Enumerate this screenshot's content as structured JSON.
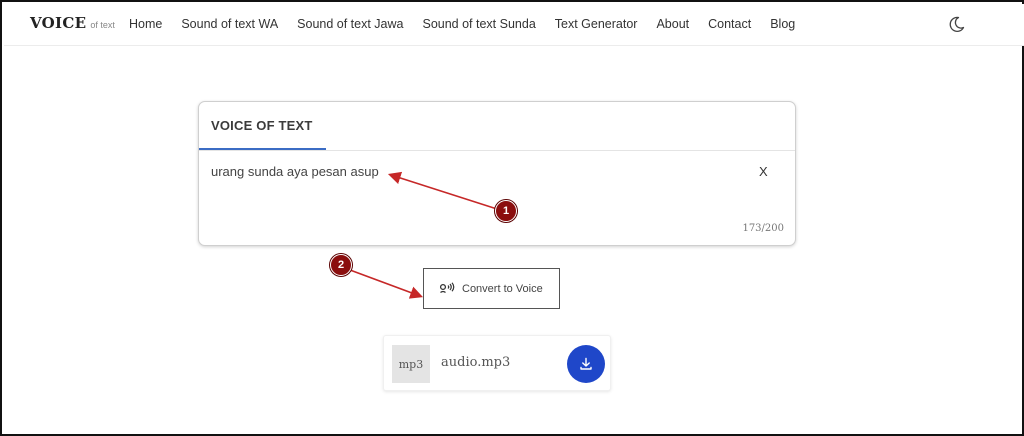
{
  "brand": {
    "name": "VOICE",
    "tagline": "of text"
  },
  "nav": {
    "links": [
      "Home",
      "Sound of text WA",
      "Sound of text Jawa",
      "Sound of text Sunda",
      "Text Generator",
      "About",
      "Contact",
      "Blog"
    ],
    "theme_icon": "moon-icon"
  },
  "card": {
    "tab_label": "VOICE OF TEXT",
    "input_value": "urang sunda aya pesan asup",
    "clear_label": "X",
    "char_count": "173/200"
  },
  "convert": {
    "label": "Convert to Voice",
    "icon": "voice-icon"
  },
  "audio": {
    "file_type": "mp3",
    "file_name": "audio.mp3",
    "download_icon": "download-icon"
  },
  "annotations": {
    "marker_1": "1",
    "marker_2": "2"
  },
  "colors": {
    "accent": "#3b6cc4",
    "download_bg": "#1f47c9",
    "annotation": "#c62828",
    "marker": "#8b0e0e"
  }
}
